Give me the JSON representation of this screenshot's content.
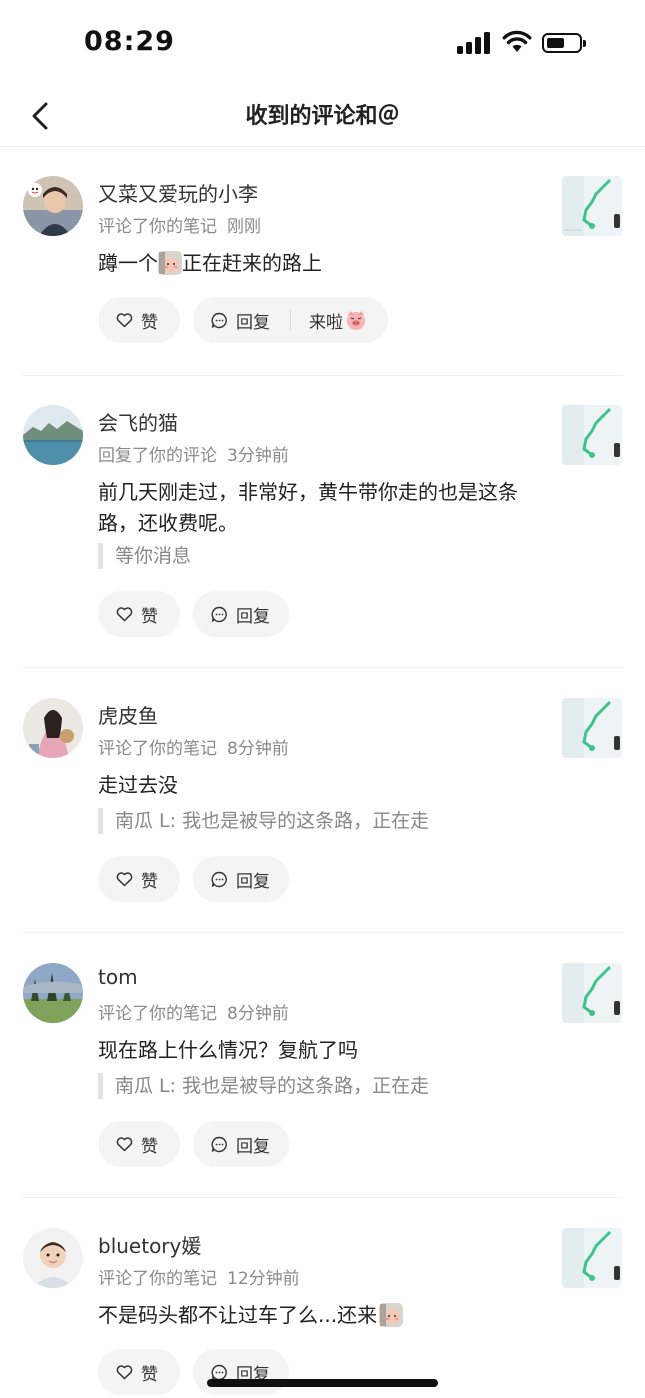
{
  "status_bar": {
    "time": "08:29"
  },
  "header": {
    "title": "收到的评论和＠"
  },
  "comments": [
    {
      "user": "又菜又爱玩的小李",
      "action": "评论了你的笔记",
      "time": "刚刚",
      "content_before": "蹲一个",
      "content_after": "正在赶来的路上",
      "quote": "",
      "like_label": "赞",
      "reply_label": "回复",
      "quick_reply": "来啦"
    },
    {
      "user": "会飞的猫",
      "action": "回复了你的评论",
      "time": "3分钟前",
      "content": "前几天刚走过，非常好，黄牛带你走的也是这条路，还收费呢。",
      "quote": "等你消息",
      "like_label": "赞",
      "reply_label": "回复"
    },
    {
      "user": "虎皮鱼",
      "action": "评论了你的笔记",
      "time": "8分钟前",
      "content": "走过去没",
      "quote": "南瓜 L: 我也是被导的这条路，正在走",
      "like_label": "赞",
      "reply_label": "回复"
    },
    {
      "user": "tom",
      "action": "评论了你的笔记",
      "time": "8分钟前",
      "content": "现在路上什么情况？复航了吗",
      "quote": "南瓜 L: 我也是被导的这条路，正在走",
      "like_label": "赞",
      "reply_label": "回复"
    },
    {
      "user": "bluetory媛",
      "action": "评论了你的笔记",
      "time": "12分钟前",
      "content": "不是码头都不让过车了么...还来",
      "quote": "",
      "like_label": "赞",
      "reply_label": "回复"
    }
  ],
  "colors": {
    "background": "#ffffff",
    "button_bg": "#f4f4f4",
    "meta_text": "#8a8a8a",
    "map_green": "#3fc38c"
  }
}
